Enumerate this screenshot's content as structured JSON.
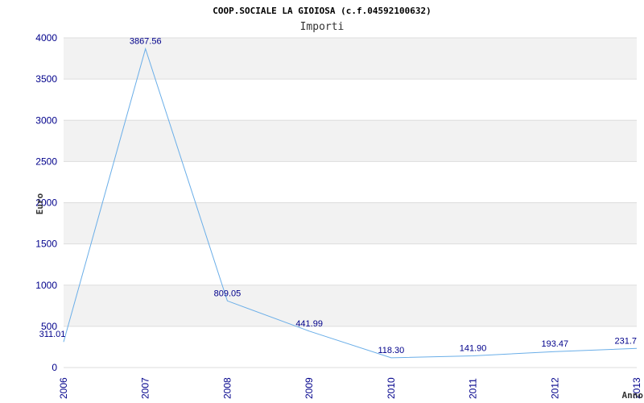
{
  "chart_data": {
    "type": "line",
    "title": "COOP.SOCIALE LA GIOIOSA (c.f.04592100632)",
    "subtitle": "Importi",
    "xlabel": "Anno",
    "ylabel": "Euro",
    "categories": [
      "2006",
      "2007",
      "2008",
      "2009",
      "2010",
      "2011",
      "2012",
      "2013"
    ],
    "values": [
      311.01,
      3867.56,
      809.05,
      441.99,
      118.3,
      141.9,
      193.47,
      231.7
    ],
    "value_labels": [
      "311.01",
      "3867.56",
      "809.05",
      "441.99",
      "118.30",
      "141.90",
      "193.47",
      "231.7"
    ],
    "ylim": [
      0,
      4000
    ],
    "yticks": [
      "0",
      "500",
      "1000",
      "1500",
      "2000",
      "2500",
      "3000",
      "3500",
      "4000"
    ],
    "grid": true,
    "colors": {
      "line": "#6aaee8",
      "band": "#f2f2f2",
      "grid": "#dddddd",
      "tick": "#00008b"
    }
  }
}
